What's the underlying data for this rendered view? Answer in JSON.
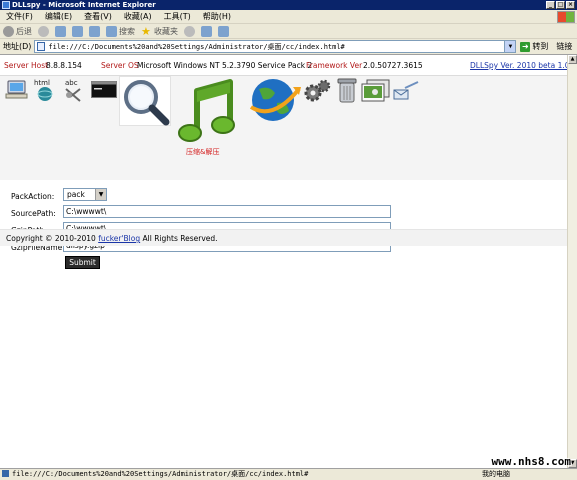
{
  "window": {
    "title": "DLLspy - Microsoft Internet Explorer",
    "controls": [
      "_",
      "□",
      "×"
    ]
  },
  "menu": [
    "文件(F)",
    "编辑(E)",
    "查看(V)",
    "收藏(A)",
    "工具(T)",
    "帮助(H)"
  ],
  "toolbar": {
    "back_label": "后退",
    "search_label": "搜索",
    "favorites_label": "收藏夹"
  },
  "address": {
    "label": "地址(D)",
    "url": "file:///C:/Documents%20and%20Settings/Administrator/桌面/cc/index.html#",
    "go_label": "转到",
    "links_label": "链接"
  },
  "info": {
    "server_host_label": "Server Host",
    "server_host": "8.8.8.154",
    "server_os_label": "Server OS",
    "server_os": "Microsoft Windows NT 5.2.3790 Service Pack 2",
    "framework_label": "Framework Ver",
    "framework": "2.0.50727.3615",
    "version_link": "DLLSpy Ver. 2010 beta 1.0"
  },
  "icons": {
    "caption": "压缩&解压",
    "names": [
      "computer-icon",
      "html-icon",
      "abc-icon",
      "console-icon",
      "magnifier-icon",
      "music-note-icon",
      "globe-icon",
      "gears-icon",
      "trash-icon",
      "photos-icon",
      "mail-icon"
    ],
    "html_text": "html",
    "abc_text": "abc"
  },
  "form": {
    "pack_action_label": "PackAction:",
    "pack_action_value": "pack",
    "source_path_label": "SourcePath:",
    "source_path_value": "C:\\wwwwt\\",
    "gzip_path_label": "GzipPath:",
    "gzip_path_value": "C:\\wwwwt\\",
    "gzip_file_label": "GzipFileName",
    "gzip_file_value": "dllspy.gzip",
    "submit_label": "Submit"
  },
  "footer": {
    "prefix": "Copyright © 2010-2010",
    "link": "fucker'Blog",
    "suffix": "All Rights Reserved."
  },
  "status": {
    "url": "file:///C:/Documents%20and%20Settings/Administrator/桌面/cc/index.html#",
    "zone": "我的电脑"
  },
  "watermark": "www.nhs8.com",
  "colors": {
    "titlebar": "#0a246a",
    "label_red": "#b21a1a",
    "link_blue": "#1a35a8",
    "caption_red": "#d42020"
  }
}
